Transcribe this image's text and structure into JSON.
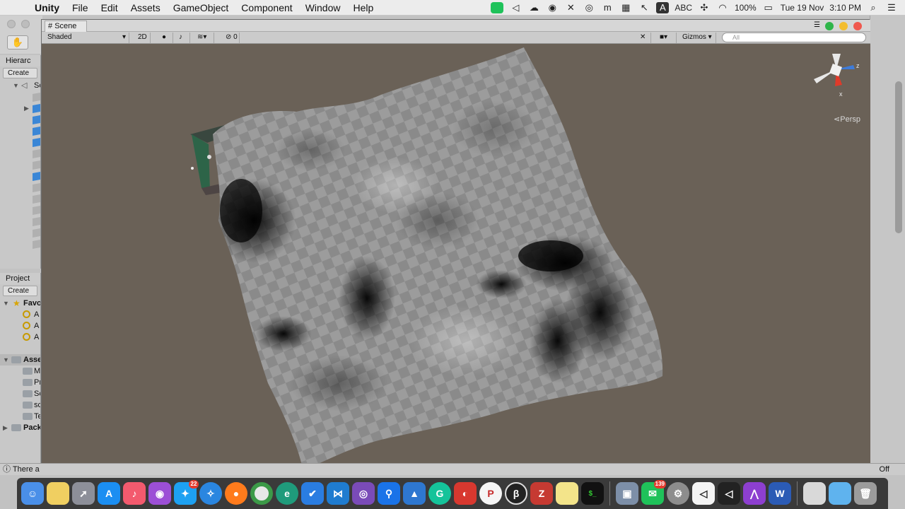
{
  "menubar": {
    "apple": "",
    "app_name": "Unity",
    "items": [
      "File",
      "Edit",
      "Assets",
      "GameObject",
      "Component",
      "Window",
      "Help"
    ],
    "tray": {
      "input_method": "A",
      "input_label": "ABC",
      "battery": "100%",
      "date": "Tue 19 Nov",
      "time": "3:10 PM"
    }
  },
  "hierarchy": {
    "tab_label": "Hierarc",
    "create_label": "Create",
    "scene_label": "Sc"
  },
  "project": {
    "tab_label": "Project",
    "create_label": "Create",
    "favorites_label": "Favo",
    "favorites_items": [
      "A",
      "A",
      "A"
    ],
    "assets_label": "Asse",
    "assets_items": [
      "M",
      "Pr",
      "Sc",
      "sc",
      "Te"
    ],
    "packages_label": "Pack"
  },
  "scene_window": {
    "tab_label": "Scene",
    "shading_mode": "Shaded",
    "mode_2d": "2D",
    "hidden_count": "0",
    "gizmos_label": "Gizmos",
    "search_placeholder": "All",
    "axis_z": "z",
    "axis_x": "x",
    "projection": "Persp"
  },
  "statusbar": {
    "message": "There a",
    "right_text": "Off"
  },
  "dock": {
    "badges": {
      "twitter": "22",
      "line": "139"
    },
    "letters": {
      "picsart": "P",
      "zotero": "Z",
      "word": "W"
    }
  },
  "colors": {
    "scene_bg": "#6a6157",
    "selected_blue": "#3a86d6",
    "window_green": "#2fb54a",
    "window_yellow": "#f3bd2f",
    "window_red": "#f0584e"
  }
}
